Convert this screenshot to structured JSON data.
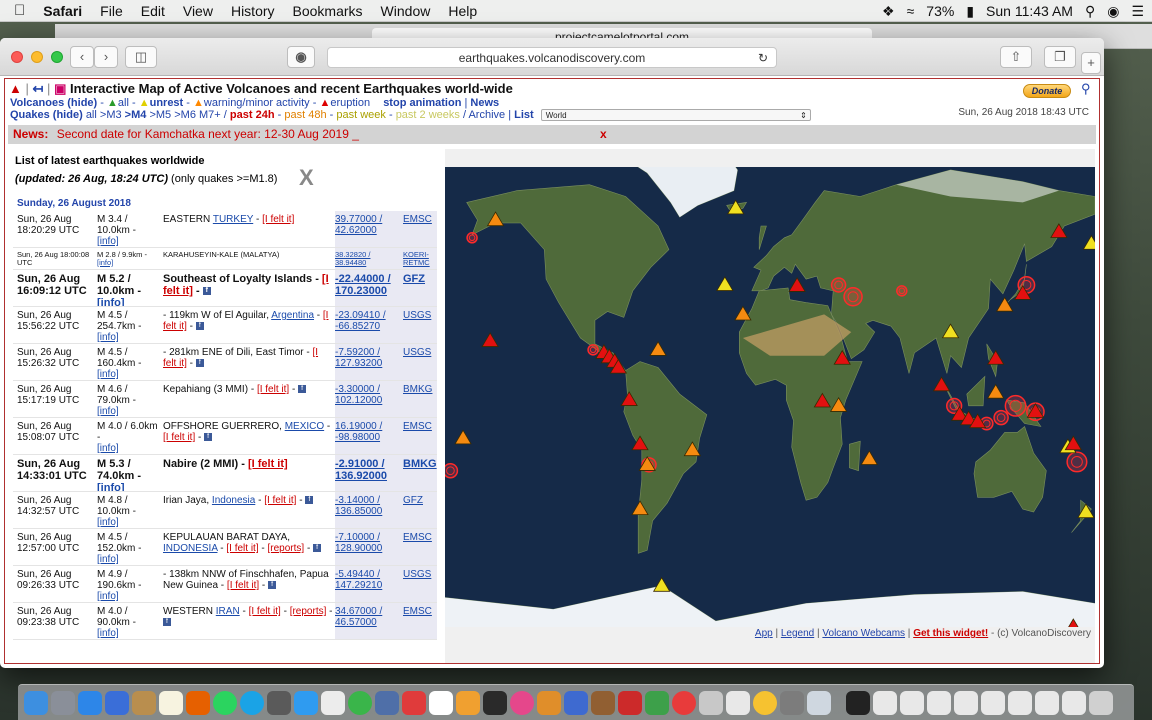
{
  "menubar": {
    "app": "Safari",
    "items": [
      "File",
      "Edit",
      "View",
      "History",
      "Bookmarks",
      "Window",
      "Help"
    ],
    "battery": "73%",
    "clock": "Sun 11:43 AM"
  },
  "browser": {
    "back_tab_url": "projectcamelotportal.com",
    "url": "earthquakes.volcanodiscovery.com"
  },
  "page": {
    "title": "Interactive Map of Active Volcanoes and recent Earthquakes world-wide",
    "volcanoes_label": "Volcanoes (hide)",
    "v_all": "all",
    "v_unrest": "unrest",
    "v_warning": "warning/minor activity",
    "v_eruption": "eruption",
    "stop_animation": "stop animation",
    "news_link": "News",
    "quakes_label": "Quakes (hide)",
    "q_all": "all",
    "q_m3": ">M3",
    "q_m4": ">M4",
    "q_m5": ">M5",
    "q_m6": ">M6",
    "q_m7": "M7+",
    "past24": "past 24h",
    "past48": "past 48h",
    "pastweek": "past week",
    "past2weeks": "past 2 weeks",
    "archive": "Archive",
    "list": "List",
    "region": "World",
    "donate": "Donate",
    "date_top": "Sun, 26 Aug 2018 18:43 UTC",
    "news_label": "News:",
    "news_text": "Second date for Kamchatka next year: 12-30 Aug 2019 _",
    "news_close": "x"
  },
  "quakes": {
    "title": "List of latest earthquakes worldwide",
    "updated": "(updated: 26 Aug, 18:24 UTC)",
    "only": " (only quakes >=M1.8)",
    "close": "X",
    "date_header": "Sunday, 26 August 2018",
    "rows": [
      {
        "time": "Sun, 26 Aug 18:20:29 UTC",
        "mag": "M 3.4 / 10.0km -",
        "info": "[info]",
        "loc_pre": "EASTERN ",
        "loc_link": "TURKEY",
        "loc_post": " - ",
        "felt": "[I felt it]",
        "fb": false,
        "reports": "",
        "coords": "39.77000 / 42.62000",
        "agency": "EMSC",
        "style": ""
      },
      {
        "time": "Sun, 26 Aug 18:00:08 UTC",
        "mag": "M 2.8 / 9.9km -",
        "info": "[info]",
        "loc_pre": "KARAHUSEYIN-KALE (MALATYA)",
        "loc_link": "",
        "loc_post": "",
        "felt": "",
        "fb": false,
        "reports": "",
        "coords": "38.32820 / 38.94480",
        "agency": "KOERI-RETMC",
        "style": "sm"
      },
      {
        "time": "Sun, 26 Aug 16:09:12 UTC",
        "mag": "M 5.2 / 10.0km -",
        "info": "[info]",
        "loc_pre": "Southeast of Loyalty Islands - ",
        "loc_link": "",
        "loc_post": "",
        "felt": "[I felt it]",
        "fb": true,
        "reports": "",
        "coords": "-22.44000 / 170.23000",
        "agency": "GFZ",
        "style": "big"
      },
      {
        "time": "Sun, 26 Aug 15:56:22 UTC",
        "mag": "M 4.5 / 254.7km -",
        "info": "[info]",
        "loc_pre": "- 119km W of El Aguilar, ",
        "loc_link": "Argentina",
        "loc_post": " - ",
        "felt": "[I felt it]",
        "fb": true,
        "reports": "",
        "coords": "-23.09410 / -66.85270",
        "agency": "USGS",
        "style": ""
      },
      {
        "time": "Sun, 26 Aug 15:26:32 UTC",
        "mag": "M 4.5 / 160.4km -",
        "info": "[info]",
        "loc_pre": "- 281km ENE of Dili, East Timor - ",
        "loc_link": "",
        "loc_post": "",
        "felt": "[I felt it]",
        "fb": true,
        "reports": "",
        "coords": "-7.59200 / 127.93200",
        "agency": "USGS",
        "style": ""
      },
      {
        "time": "Sun, 26 Aug 15:17:19 UTC",
        "mag": "M 4.6 / 79.0km -",
        "info": "[info]",
        "loc_pre": "Kepahiang (3 MMI) - ",
        "loc_link": "",
        "loc_post": "",
        "felt": "[I felt it]",
        "fb": true,
        "reports": "",
        "coords": "-3.30000 / 102.12000",
        "agency": "BMKG",
        "style": ""
      },
      {
        "time": "Sun, 26 Aug 15:08:07 UTC",
        "mag": "M 4.0 / 6.0km - ",
        "info": "[info]",
        "loc_pre": "OFFSHORE GUERRERO, ",
        "loc_link": "MEXICO",
        "loc_post": " - ",
        "felt": "[I felt it]",
        "fb": true,
        "reports": "",
        "coords": "16.19000 / -98.98000",
        "agency": "EMSC",
        "style": ""
      },
      {
        "time": "Sun, 26 Aug 14:33:01 UTC",
        "mag": "M 5.3 / 74.0km -",
        "info": "[info]",
        "loc_pre": "Nabire (2 MMI) - ",
        "loc_link": "",
        "loc_post": "",
        "felt": "[I felt it]",
        "fb": false,
        "reports": "",
        "coords": "-2.91000 / 136.92000",
        "agency": "BMKG",
        "style": "big"
      },
      {
        "time": "Sun, 26 Aug 14:32:57 UTC",
        "mag": "M 4.8 / 10.0km -",
        "info": "[info]",
        "loc_pre": "Irian Jaya, ",
        "loc_link": "Indonesia",
        "loc_post": " - ",
        "felt": "[I felt it]",
        "fb": true,
        "reports": "",
        "coords": "-3.14000 / 136.85000",
        "agency": "GFZ",
        "style": ""
      },
      {
        "time": "Sun, 26 Aug 12:57:00 UTC",
        "mag": "M 4.5 / 152.0km -",
        "info": "[info]",
        "loc_pre": "KEPULAUAN BARAT DAYA, ",
        "loc_link": "INDONESIA",
        "loc_post": " - ",
        "felt": "[I felt it]",
        "fb": true,
        "reports": "[reports]",
        "coords": "-7.10000 / 128.90000",
        "agency": "EMSC",
        "style": ""
      },
      {
        "time": "Sun, 26 Aug 09:26:33 UTC",
        "mag": "M 4.9 / 190.6km -",
        "info": "[info]",
        "loc_pre": "- 138km NNW of Finschhafen, Papua New Guinea - ",
        "loc_link": "",
        "loc_post": "",
        "felt": "[I felt it]",
        "fb": true,
        "reports": "",
        "coords": "-5.49440 / 147.29210",
        "agency": "USGS",
        "style": ""
      },
      {
        "time": "Sun, 26 Aug 09:23:38 UTC",
        "mag": "M 4.0 / 90.0km -",
        "info": "[info]",
        "loc_pre": "WESTERN ",
        "loc_link": "IRAN",
        "loc_post": " - ",
        "felt": "[I felt it]",
        "fb": true,
        "reports": "[reports]",
        "coords": "34.67000 / 46.57000",
        "agency": "EMSC",
        "style": ""
      }
    ]
  },
  "map": {
    "footer": {
      "app": "App",
      "legend": "Legend",
      "webcams": "Volcano Webcams",
      "widget": "Get this widget!",
      "credit": " - (c) VolcanoDiscovery"
    },
    "volcanoes": [
      {
        "lon": -152,
        "lat": 60,
        "level": "warning"
      },
      {
        "lon": -155,
        "lat": 19,
        "level": "eruption"
      },
      {
        "lon": -92,
        "lat": 15,
        "level": "eruption"
      },
      {
        "lon": -89,
        "lat": 13.5,
        "level": "eruption"
      },
      {
        "lon": -86,
        "lat": 12,
        "level": "eruption"
      },
      {
        "lon": -84,
        "lat": 10,
        "level": "eruption"
      },
      {
        "lon": -78,
        "lat": -1,
        "level": "eruption"
      },
      {
        "lon": -72,
        "lat": -16,
        "level": "eruption"
      },
      {
        "lon": -68,
        "lat": -23,
        "level": "warning"
      },
      {
        "lon": -72,
        "lat": -38,
        "level": "warning"
      },
      {
        "lon": -62,
        "lat": 16,
        "level": "warning"
      },
      {
        "lon": -19,
        "lat": 64,
        "level": "unrest"
      },
      {
        "lon": 15,
        "lat": 37.7,
        "level": "eruption"
      },
      {
        "lon": 40,
        "lat": 13,
        "level": "eruption"
      },
      {
        "lon": 29,
        "lat": -1.5,
        "level": "eruption"
      },
      {
        "lon": 55,
        "lat": -21,
        "level": "warning"
      },
      {
        "lon": 38,
        "lat": -3,
        "level": "warning"
      },
      {
        "lon": -25,
        "lat": 38,
        "level": "unrest"
      },
      {
        "lon": 160,
        "lat": 56,
        "level": "eruption"
      },
      {
        "lon": 178,
        "lat": 52,
        "level": "unrest"
      },
      {
        "lon": 140,
        "lat": 35,
        "level": "eruption"
      },
      {
        "lon": 130,
        "lat": 31,
        "level": "warning"
      },
      {
        "lon": 125,
        "lat": 13,
        "level": "eruption"
      },
      {
        "lon": 105,
        "lat": -6,
        "level": "eruption"
      },
      {
        "lon": 110,
        "lat": -7.5,
        "level": "eruption"
      },
      {
        "lon": 125,
        "lat": 1.5,
        "level": "warning"
      },
      {
        "lon": 115,
        "lat": -8.5,
        "level": "eruption"
      },
      {
        "lon": 147,
        "lat": -5,
        "level": "eruption"
      },
      {
        "lon": 165,
        "lat": -17,
        "level": "unrest"
      },
      {
        "lon": 168,
        "lat": -16,
        "level": "eruption"
      },
      {
        "lon": 175,
        "lat": -39,
        "level": "unrest"
      },
      {
        "lon": -170,
        "lat": -14,
        "level": "warning"
      },
      {
        "lon": -43,
        "lat": -18,
        "level": "warning"
      },
      {
        "lon": -15,
        "lat": 28,
        "level": "warning"
      },
      {
        "lon": 168,
        "lat": -78,
        "level": "eruption"
      },
      {
        "lon": -60,
        "lat": -64,
        "level": "unrest"
      },
      {
        "lon": 100,
        "lat": 22,
        "level": "unrest"
      },
      {
        "lon": 95,
        "lat": 4,
        "level": "eruption"
      }
    ],
    "quakes": [
      {
        "lon": -165,
        "lat": 54,
        "mag": 4
      },
      {
        "lon": -98,
        "lat": 16,
        "mag": 4
      },
      {
        "lon": -67,
        "lat": -23,
        "mag": 4.5
      },
      {
        "lon": 38,
        "lat": 38,
        "mag": 4.5
      },
      {
        "lon": 46,
        "lat": 34,
        "mag": 5
      },
      {
        "lon": 73,
        "lat": 36,
        "mag": 4
      },
      {
        "lon": 136,
        "lat": -3,
        "mag": 5.3
      },
      {
        "lon": 128,
        "lat": -7,
        "mag": 4.5
      },
      {
        "lon": 147,
        "lat": -5,
        "mag": 4.9
      },
      {
        "lon": 170,
        "lat": -22,
        "mag": 5.2
      },
      {
        "lon": 102,
        "lat": -3,
        "mag": 4.6
      },
      {
        "lon": 142,
        "lat": 38,
        "mag": 4.8
      },
      {
        "lon": -177,
        "lat": -25,
        "mag": 4.5
      },
      {
        "lon": 120,
        "lat": -9,
        "mag": 4.3
      }
    ]
  }
}
